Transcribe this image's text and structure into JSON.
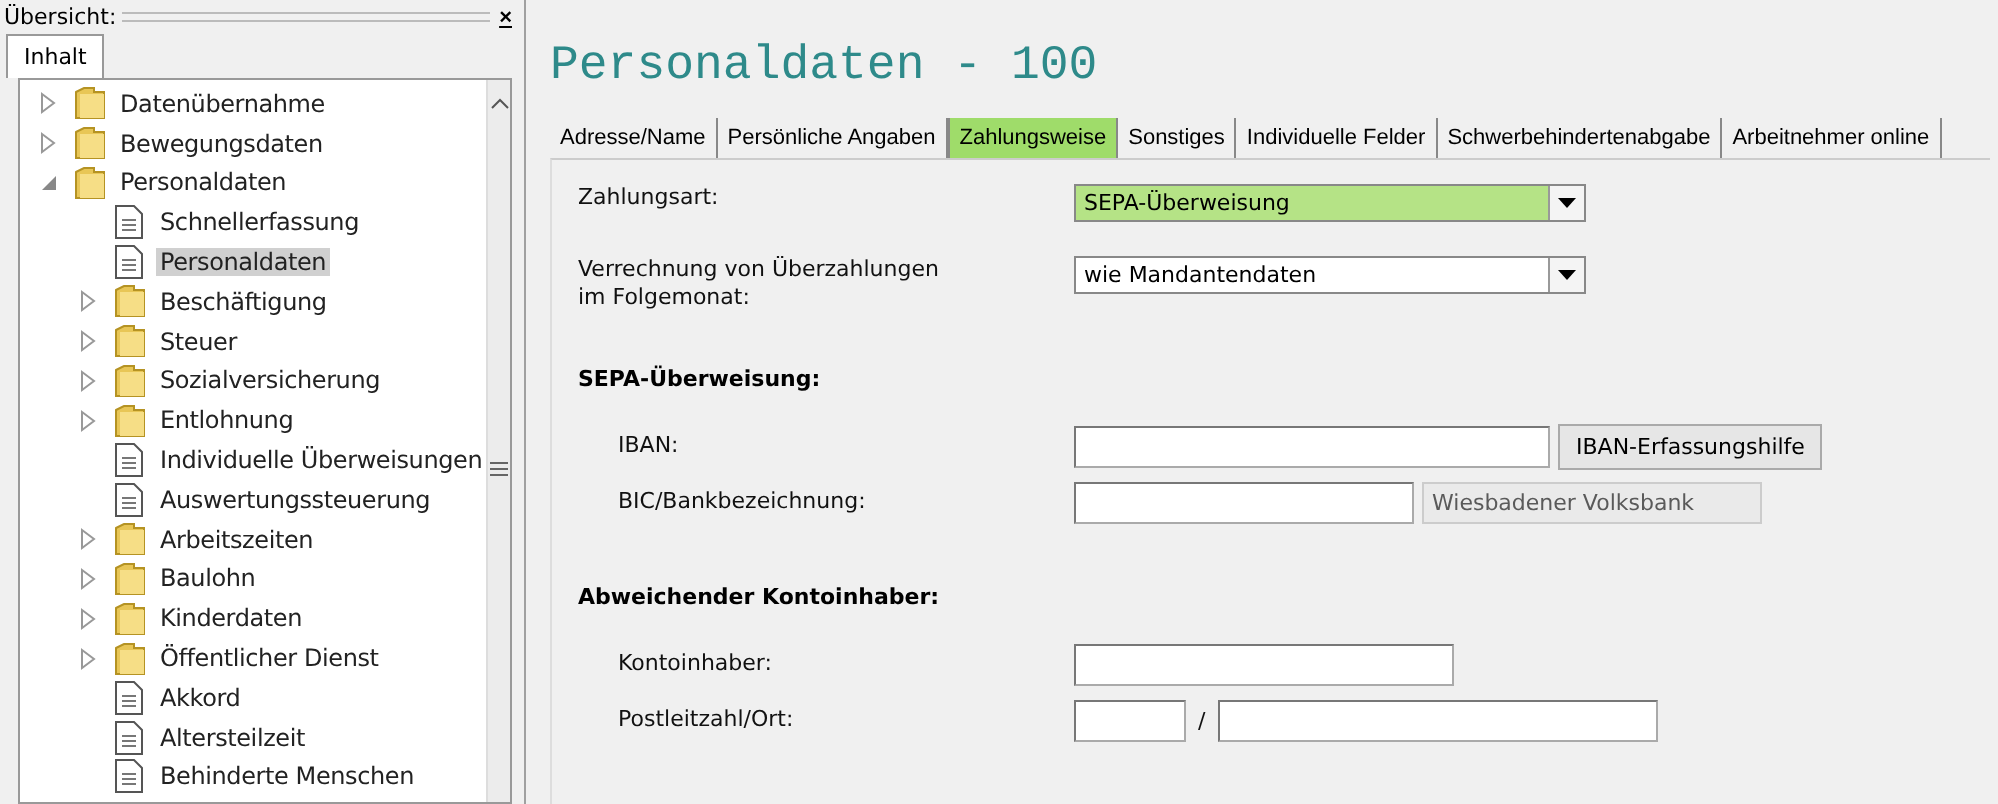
{
  "overview": {
    "title": "Übersicht:",
    "close": "×",
    "tabs": [
      {
        "label": "Inhalt",
        "selected": true
      }
    ]
  },
  "tree": [
    {
      "label": "Datenübernahme",
      "kind": "folder",
      "expanded": false,
      "selected": false
    },
    {
      "label": "Bewegungsdaten",
      "kind": "folder",
      "expanded": false,
      "selected": false
    },
    {
      "label": "Personaldaten",
      "kind": "folder",
      "expanded": true,
      "selected": false,
      "children": [
        {
          "label": "Schnellerfassung",
          "kind": "document",
          "selected": false
        },
        {
          "label": "Personaldaten",
          "kind": "document",
          "selected": true
        },
        {
          "label": "Beschäftigung",
          "kind": "folder",
          "expanded": false,
          "selected": false
        },
        {
          "label": "Steuer",
          "kind": "folder",
          "expanded": false,
          "selected": false
        },
        {
          "label": "Sozialversicherung",
          "kind": "folder",
          "expanded": false,
          "selected": false
        },
        {
          "label": "Entlohnung",
          "kind": "folder",
          "expanded": false,
          "selected": false
        },
        {
          "label": "Individuelle Überweisungen",
          "kind": "document",
          "selected": false
        },
        {
          "label": "Auswertungssteuerung",
          "kind": "document",
          "selected": false
        },
        {
          "label": "Arbeitszeiten",
          "kind": "folder",
          "expanded": false,
          "selected": false
        },
        {
          "label": "Baulohn",
          "kind": "folder",
          "expanded": false,
          "selected": false
        },
        {
          "label": "Kinderdaten",
          "kind": "folder",
          "expanded": false,
          "selected": false
        },
        {
          "label": "Öffentlicher Dienst",
          "kind": "folder",
          "expanded": false,
          "selected": false
        },
        {
          "label": "Akkord",
          "kind": "document",
          "selected": false
        },
        {
          "label": "Altersteilzeit",
          "kind": "document",
          "selected": false
        },
        {
          "label": "Behinderte Menschen",
          "kind": "document",
          "selected": false
        }
      ]
    }
  ],
  "page": {
    "title": "Personaldaten - 100"
  },
  "tabs": [
    {
      "label": "Adresse/Name",
      "selected": false
    },
    {
      "label": "Persönliche Angaben",
      "selected": false
    },
    {
      "label": "Zahlungsweise",
      "selected": true
    },
    {
      "label": "Sonstiges",
      "selected": false
    },
    {
      "label": "Individuelle Felder",
      "selected": false
    },
    {
      "label": "Schwerbehindertenabgabe",
      "selected": false
    },
    {
      "label": "Arbeitnehmer online",
      "selected": false
    }
  ],
  "form": [
    {
      "kind": "row",
      "label": "Zahlungsart:",
      "fields": [
        {
          "kind": "select",
          "value": "SEPA-Überweisung",
          "highlighted": true
        }
      ]
    },
    {
      "kind": "row",
      "label": "Verrechnung von Überzahlungen\nim Folgemonat:",
      "fields": [
        {
          "kind": "select",
          "value": "wie Mandantendaten",
          "highlighted": false
        }
      ]
    },
    {
      "kind": "heading",
      "label": "SEPA-Überweisung:"
    },
    {
      "kind": "subrow",
      "label": "IBAN:",
      "fields": [
        {
          "kind": "input"
        },
        {
          "kind": "button",
          "value": "IBAN-Erfassungshilfe"
        }
      ]
    },
    {
      "kind": "subrow",
      "label": "BIC/Bankbezeichnung:",
      "fields": [
        {
          "kind": "input"
        },
        {
          "kind": "readonly",
          "value": "Wiesbadener Volksbank"
        }
      ]
    },
    {
      "kind": "heading",
      "label": "Abweichender Kontoinhaber:"
    },
    {
      "kind": "subrow",
      "label": "Kontoinhaber:",
      "fields": [
        {
          "kind": "input"
        }
      ]
    },
    {
      "kind": "subrow",
      "label": "Postleitzahl/Ort:",
      "fields": [
        {
          "kind": "input"
        },
        {
          "kind": "separator",
          "value": "/"
        },
        {
          "kind": "input"
        }
      ]
    }
  ]
}
